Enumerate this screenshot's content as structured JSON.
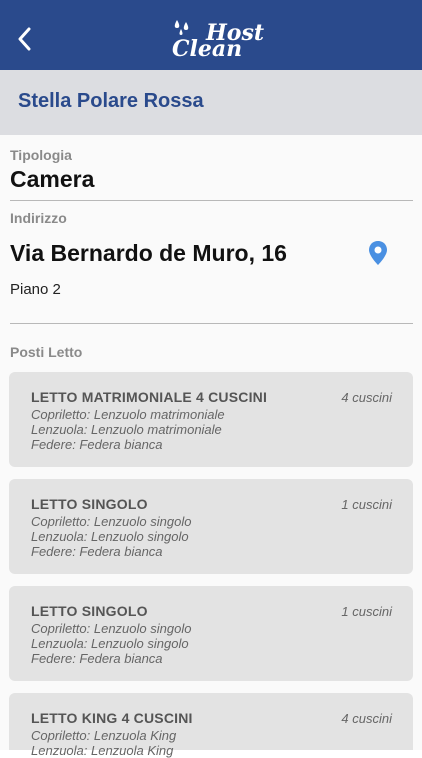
{
  "header": {
    "back_icon": "chevron-left-icon",
    "logo_top": "Host",
    "logo_bottom": "Clean"
  },
  "page": {
    "title": "Stella Polare Rossa"
  },
  "details": {
    "tipologia_label": "Tipologia",
    "tipologia_value": "Camera",
    "indirizzo_label": "Indirizzo",
    "indirizzo_value": "Via Bernardo de Muro, 16",
    "piano": "Piano 2",
    "map_icon": "map-pin-icon",
    "posti_letto_label": "Posti Letto"
  },
  "beds": [
    {
      "name": "LETTO MATRIMONIALE 4 CUSCINI",
      "cuscini": "4 cuscini",
      "copriletto": "Copriletto: Lenzuolo matrimoniale",
      "lenzuola": "Lenzuola: Lenzuolo matrimoniale",
      "federe": "Federe: Federa bianca"
    },
    {
      "name": "LETTO SINGOLO",
      "cuscini": "1 cuscini",
      "copriletto": "Copriletto: Lenzuolo singolo",
      "lenzuola": "Lenzuola: Lenzuolo singolo",
      "federe": "Federe: Federa bianca"
    },
    {
      "name": "LETTO SINGOLO",
      "cuscini": "1 cuscini",
      "copriletto": "Copriletto: Lenzuolo singolo",
      "lenzuola": "Lenzuola: Lenzuolo singolo",
      "federe": "Federe: Federa bianca"
    },
    {
      "name": "LETTO KING 4 CUSCINI",
      "cuscini": "4 cuscini",
      "copriletto": "Copriletto: Lenzuola King",
      "lenzuola": "Lenzuola: Lenzuola King",
      "federe": ""
    }
  ],
  "colors": {
    "primary": "#2a4a8c",
    "pin": "#4a90e2",
    "card": "#e3e3e3"
  }
}
